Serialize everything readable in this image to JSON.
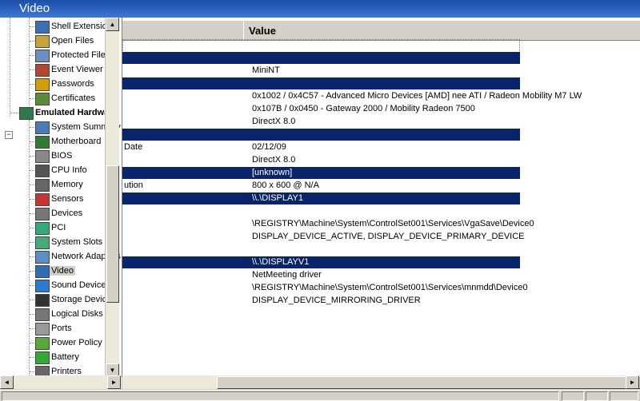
{
  "window": {
    "title": "Video"
  },
  "tree": {
    "items": [
      {
        "label": "Shell Extensions",
        "icon": "shell-extensions-icon"
      },
      {
        "label": "Open Files",
        "icon": "open-files-icon"
      },
      {
        "label": "Protected Files",
        "icon": "protected-files-icon"
      },
      {
        "label": "Event Viewer",
        "icon": "event-viewer-icon"
      },
      {
        "label": "Passwords",
        "icon": "key-icon"
      },
      {
        "label": "Certificates",
        "icon": "certificate-icon"
      },
      {
        "label": "Emulated Hardware",
        "icon": "hardware-icon"
      },
      {
        "label": "System Summary",
        "icon": "system-summary-icon"
      },
      {
        "label": "Motherboard",
        "icon": "motherboard-icon"
      },
      {
        "label": "BIOS",
        "icon": "bios-icon"
      },
      {
        "label": "CPU Info",
        "icon": "cpu-icon"
      },
      {
        "label": "Memory",
        "icon": "memory-icon"
      },
      {
        "label": "Sensors",
        "icon": "sensors-icon"
      },
      {
        "label": "Devices",
        "icon": "devices-icon"
      },
      {
        "label": "PCI",
        "icon": "pci-icon"
      },
      {
        "label": "System Slots",
        "icon": "system-slots-icon"
      },
      {
        "label": "Network Adapters",
        "icon": "network-adapter-icon"
      },
      {
        "label": "Video",
        "icon": "monitor-icon"
      },
      {
        "label": "Sound Devices",
        "icon": "speaker-icon"
      },
      {
        "label": "Storage Devices",
        "icon": "storage-icon"
      },
      {
        "label": "Logical Disks",
        "icon": "disk-icon"
      },
      {
        "label": "Ports",
        "icon": "ports-icon"
      },
      {
        "label": "Power Policy",
        "icon": "power-icon"
      },
      {
        "label": "Battery",
        "icon": "battery-icon"
      },
      {
        "label": "Printers",
        "icon": "printer-icon"
      }
    ],
    "expander_symbol": "−"
  },
  "table": {
    "columns": [
      "",
      "Value"
    ],
    "rows": [
      {
        "field": "",
        "value": ""
      },
      {
        "field": "",
        "value": "",
        "highlight": true
      },
      {
        "field": "",
        "value": "MiniNT"
      },
      {
        "field": "",
        "value": "",
        "highlight": true
      },
      {
        "field": "",
        "value": "0x1002 / 0x4C57 - Advanced Micro Devices [AMD] nee ATI / Radeon Mobility M7 LW"
      },
      {
        "field": "",
        "value": "0x107B / 0x0450 - Gateway 2000 / Mobility Radeon 7500"
      },
      {
        "field": "",
        "value": "DirectX 8.0"
      },
      {
        "field": "",
        "value": "",
        "highlight": true
      },
      {
        "field": "Date",
        "value": "02/12/09"
      },
      {
        "field": "",
        "value": "DirectX 8.0"
      },
      {
        "field": "",
        "value": "[unknown]",
        "highlight": true
      },
      {
        "field": "ution",
        "value": "800 x 600 @ N/A"
      },
      {
        "field": "",
        "value": "\\\\.\\DISPLAY1",
        "highlight": true
      },
      {
        "field": "",
        "value": ""
      },
      {
        "field": "",
        "value": "\\REGISTRY\\Machine\\System\\ControlSet001\\Services\\VgaSave\\Device0"
      },
      {
        "field": "",
        "value": "DISPLAY_DEVICE_ACTIVE, DISPLAY_DEVICE_PRIMARY_DEVICE"
      },
      {
        "field": "",
        "value": ""
      },
      {
        "field": "",
        "value": "\\\\.\\DISPLAYV1",
        "highlight": true
      },
      {
        "field": "",
        "value": "NetMeeting driver"
      },
      {
        "field": "",
        "value": "\\REGISTRY\\Machine\\System\\ControlSet001\\Services\\mnmdd\\Device0"
      },
      {
        "field": "",
        "value": "DISPLAY_DEVICE_MIRRORING_DRIVER"
      }
    ]
  },
  "scroll": {
    "up": "▲",
    "down": "▼",
    "left": "◄",
    "right": "►"
  },
  "colors": {
    "title_bar": "#1c4fa8",
    "highlight_row": "#0a246a",
    "window_face": "#d4d0c8"
  }
}
